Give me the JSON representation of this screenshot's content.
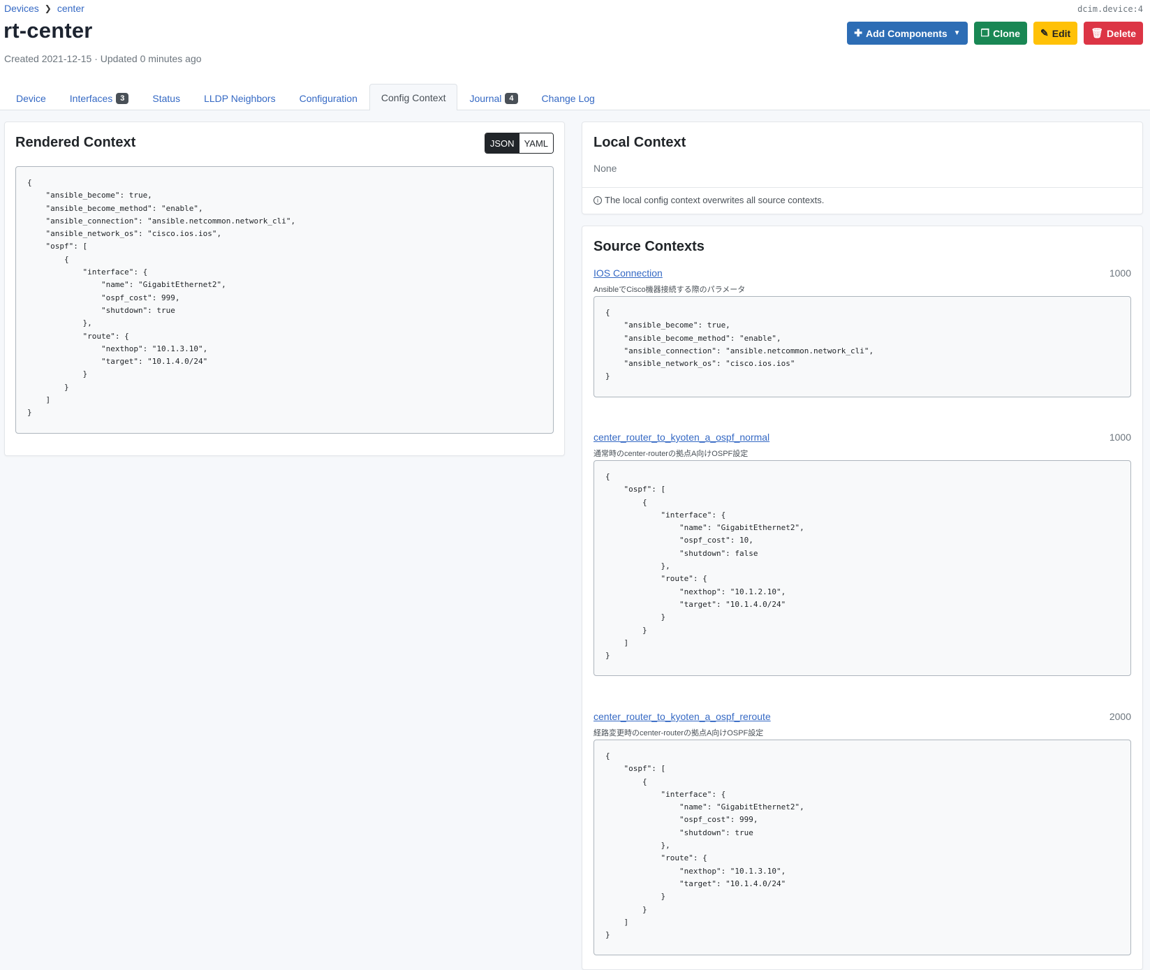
{
  "breadcrumb": [
    "Devices",
    "center"
  ],
  "object_id": "dcim.device:4",
  "title": "rt-center",
  "meta": "Created 2021-12-15 · Updated 0 minutes ago",
  "actions": {
    "add_components": "Add Components",
    "clone": "Clone",
    "edit": "Edit",
    "delete": "Delete"
  },
  "tabs": [
    {
      "label": "Device",
      "badge": null
    },
    {
      "label": "Interfaces",
      "badge": "3"
    },
    {
      "label": "Status",
      "badge": null
    },
    {
      "label": "LLDP Neighbors",
      "badge": null
    },
    {
      "label": "Configuration",
      "badge": null
    },
    {
      "label": "Config Context",
      "badge": null,
      "active": true
    },
    {
      "label": "Journal",
      "badge": "4"
    },
    {
      "label": "Change Log",
      "badge": null
    }
  ],
  "rendered": {
    "title": "Rendered Context",
    "format_json": "JSON",
    "format_yaml": "YAML",
    "code": "{\n    \"ansible_become\": true,\n    \"ansible_become_method\": \"enable\",\n    \"ansible_connection\": \"ansible.netcommon.network_cli\",\n    \"ansible_network_os\": \"cisco.ios.ios\",\n    \"ospf\": [\n        {\n            \"interface\": {\n                \"name\": \"GigabitEthernet2\",\n                \"ospf_cost\": 999,\n                \"shutdown\": true\n            },\n            \"route\": {\n                \"nexthop\": \"10.1.3.10\",\n                \"target\": \"10.1.4.0/24\"\n            }\n        }\n    ]\n}"
  },
  "local": {
    "title": "Local Context",
    "value": "None",
    "note": "The local config context overwrites all source contexts."
  },
  "sources": {
    "title": "Source Contexts",
    "items": [
      {
        "name": "IOS Connection",
        "weight": "1000",
        "description": "AnsibleでCisco機器接続する際のパラメータ",
        "code": "{\n    \"ansible_become\": true,\n    \"ansible_become_method\": \"enable\",\n    \"ansible_connection\": \"ansible.netcommon.network_cli\",\n    \"ansible_network_os\": \"cisco.ios.ios\"\n}"
      },
      {
        "name": "center_router_to_kyoten_a_ospf_normal",
        "weight": "1000",
        "description": "通常時のcenter-routerの拠点A向けOSPF設定",
        "code": "{\n    \"ospf\": [\n        {\n            \"interface\": {\n                \"name\": \"GigabitEthernet2\",\n                \"ospf_cost\": 10,\n                \"shutdown\": false\n            },\n            \"route\": {\n                \"nexthop\": \"10.1.2.10\",\n                \"target\": \"10.1.4.0/24\"\n            }\n        }\n    ]\n}"
      },
      {
        "name": "center_router_to_kyoten_a_ospf_reroute",
        "weight": "2000",
        "description": "経路変更時のcenter-routerの拠点A向けOSPF設定",
        "code": "{\n    \"ospf\": [\n        {\n            \"interface\": {\n                \"name\": \"GigabitEthernet2\",\n                \"ospf_cost\": 999,\n                \"shutdown\": true\n            },\n            \"route\": {\n                \"nexthop\": \"10.1.3.10\",\n                \"target\": \"10.1.4.0/24\"\n            }\n        }\n    ]\n}"
      }
    ]
  },
  "colors": {
    "primary": "#2d6db5",
    "success": "#198754",
    "warning": "#ffc107",
    "danger": "#dc3545",
    "link": "#3569c4"
  }
}
